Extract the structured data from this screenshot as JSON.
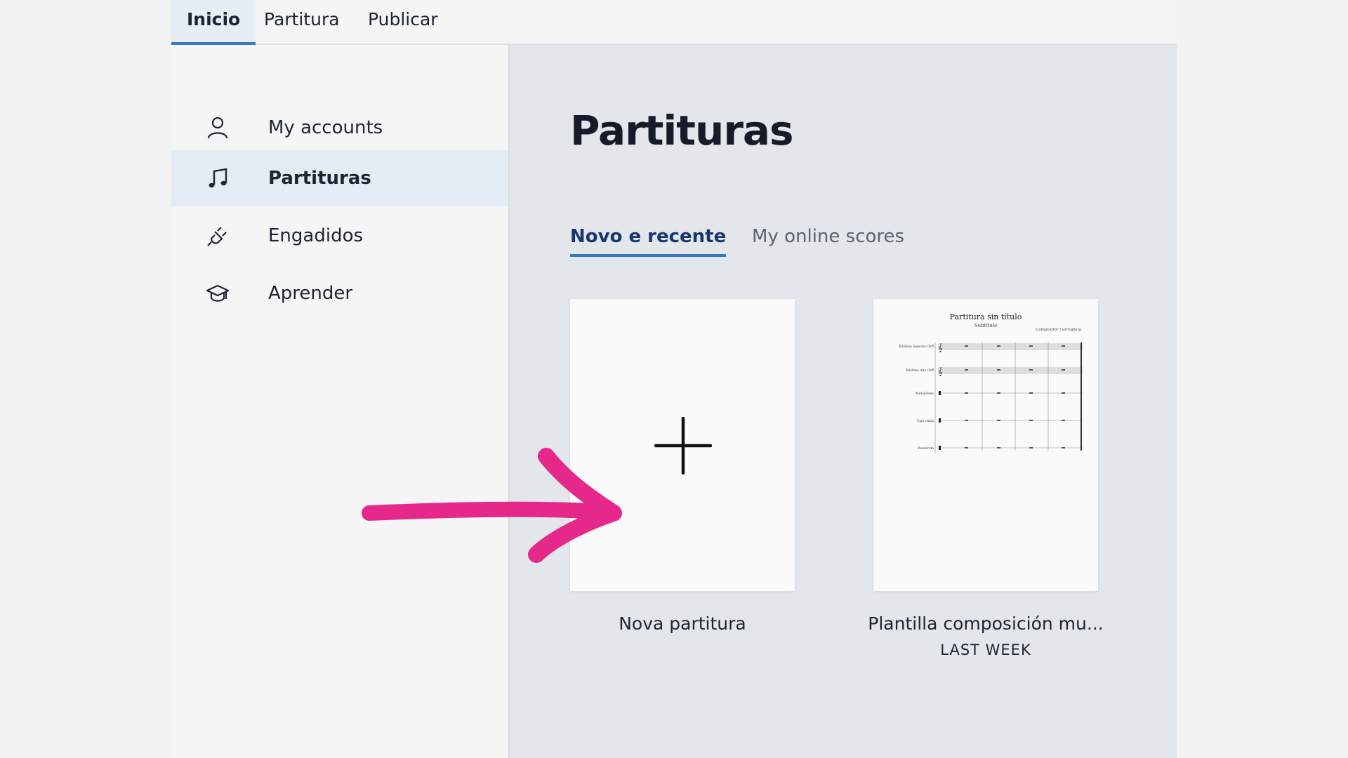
{
  "top_tabs": [
    "Inicio",
    "Partitura",
    "Publicar"
  ],
  "sidebar": {
    "items": [
      {
        "label": "My accounts",
        "icon": "user-icon"
      },
      {
        "label": "Partituras",
        "icon": "music-note-icon"
      },
      {
        "label": "Engadidos",
        "icon": "plug-icon"
      },
      {
        "label": "Aprender",
        "icon": "graduation-cap-icon"
      }
    ]
  },
  "main": {
    "title": "Partituras",
    "tabs": [
      "Novo e recente",
      "My online scores"
    ],
    "cards": [
      {
        "label": "Nova partitura",
        "icon": "plus-icon"
      },
      {
        "label": "Plantilla composición mu...",
        "meta": "LAST WEEK",
        "thumbnail": {
          "title": "Partitura sin título",
          "subtitle": "Subtítulo",
          "composer": "Compositor / arreglista",
          "instruments": [
            "Xilófono Soprano Orff",
            "Xilófono Alto Orff",
            "Metalófono",
            "Caja china",
            "Pandereta"
          ]
        }
      }
    ]
  },
  "colors": {
    "accent": "#3a78c3",
    "annotation_arrow": "#e5288a"
  }
}
